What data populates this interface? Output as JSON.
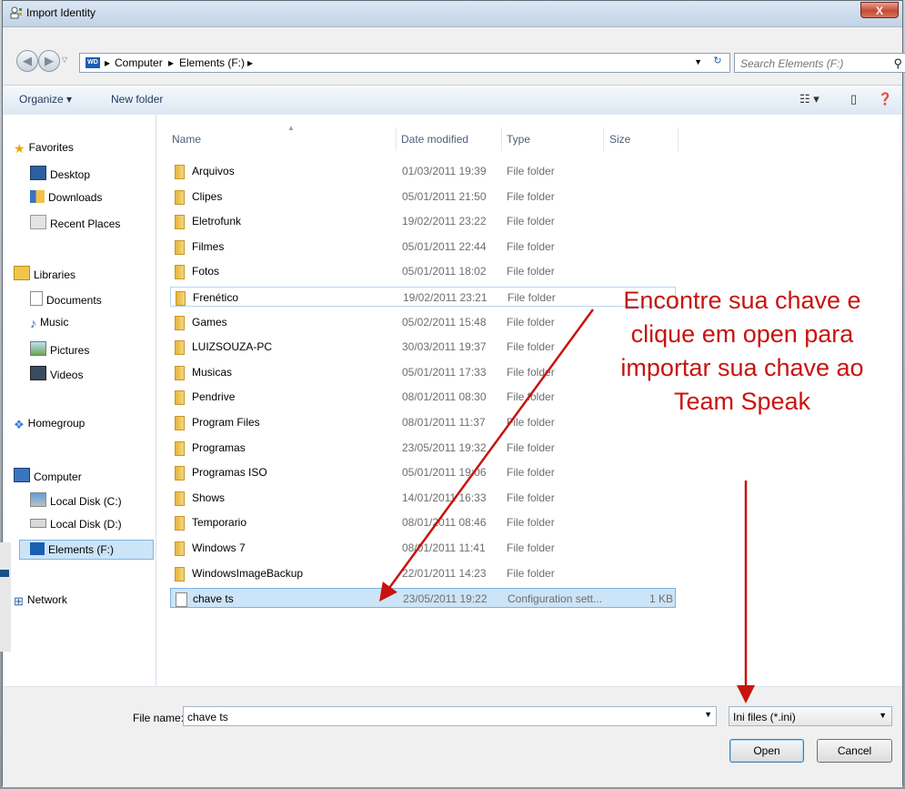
{
  "window": {
    "title": "Import Identity",
    "close_label": "X"
  },
  "address": {
    "drive_badge": "WD",
    "crumbs": [
      "Computer",
      "Elements (F:)"
    ],
    "separator": "▸"
  },
  "search": {
    "placeholder": "Search Elements (F:)"
  },
  "toolbar": {
    "organize_label": "Organize ▾",
    "new_folder_label": "New folder"
  },
  "nav": {
    "favorites": {
      "label": "Favorites",
      "items": [
        "Desktop",
        "Downloads",
        "Recent Places"
      ]
    },
    "libraries": {
      "label": "Libraries",
      "items": [
        "Documents",
        "Music",
        "Pictures",
        "Videos"
      ]
    },
    "homegroup": "Homegroup",
    "computer": {
      "label": "Computer",
      "items": [
        "Local Disk (C:)",
        "Local Disk (D:)",
        "Elements (F:)"
      ]
    },
    "network": "Network"
  },
  "columns": {
    "name": "Name",
    "date": "Date modified",
    "type": "Type",
    "size": "Size"
  },
  "files": [
    {
      "name": "Arquivos",
      "date": "01/03/2011 19:39",
      "type": "File folder",
      "size": ""
    },
    {
      "name": "Clipes",
      "date": "05/01/2011 21:50",
      "type": "File folder",
      "size": ""
    },
    {
      "name": "Eletrofunk",
      "date": "19/02/2011 23:22",
      "type": "File folder",
      "size": ""
    },
    {
      "name": "Filmes",
      "date": "05/01/2011 22:44",
      "type": "File folder",
      "size": ""
    },
    {
      "name": "Fotos",
      "date": "05/01/2011 18:02",
      "type": "File folder",
      "size": ""
    },
    {
      "name": "Frenético",
      "date": "19/02/2011 23:21",
      "type": "File folder",
      "size": ""
    },
    {
      "name": "Games",
      "date": "05/02/2011 15:48",
      "type": "File folder",
      "size": ""
    },
    {
      "name": "LUIZSOUZA-PC",
      "date": "30/03/2011 19:37",
      "type": "File folder",
      "size": ""
    },
    {
      "name": "Musicas",
      "date": "05/01/2011 17:33",
      "type": "File folder",
      "size": ""
    },
    {
      "name": "Pendrive",
      "date": "08/01/2011 08:30",
      "type": "File folder",
      "size": ""
    },
    {
      "name": "Program Files",
      "date": "08/01/2011 11:37",
      "type": "File folder",
      "size": ""
    },
    {
      "name": "Programas",
      "date": "23/05/2011 19:32",
      "type": "File folder",
      "size": ""
    },
    {
      "name": "Programas ISO",
      "date": "05/01/2011 19:06",
      "type": "File folder",
      "size": ""
    },
    {
      "name": "Shows",
      "date": "14/01/2011 16:33",
      "type": "File folder",
      "size": ""
    },
    {
      "name": "Temporario",
      "date": "08/01/2011 08:46",
      "type": "File folder",
      "size": ""
    },
    {
      "name": "Windows 7",
      "date": "08/01/2011 11:41",
      "type": "File folder",
      "size": ""
    },
    {
      "name": "WindowsImageBackup",
      "date": "22/01/2011 14:23",
      "type": "File folder",
      "size": ""
    },
    {
      "name": "chave ts",
      "date": "23/05/2011 19:22",
      "type": "Configuration sett...",
      "size": "1 KB"
    }
  ],
  "footer": {
    "file_name_label": "File name:",
    "file_name_value": "chave ts",
    "filter_value": "Ini files (*.ini)",
    "open_label": "Open",
    "cancel_label": "Cancel"
  },
  "annotation": {
    "lines": [
      "Encontre sua chave e",
      "clique em open para",
      "importar sua chave ao",
      "Team Speak"
    ],
    "color": "#c8140f"
  },
  "colors": {
    "selection": "#cce4f7",
    "link": "#1e395b"
  }
}
